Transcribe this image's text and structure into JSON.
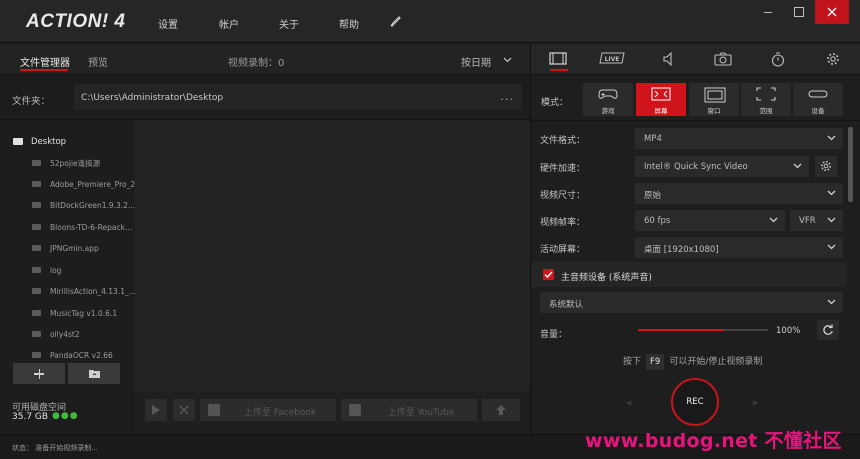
{
  "app": {
    "logo": "ACTION! 4"
  },
  "menu": {
    "settings": "设置",
    "account": "帐户",
    "about": "关于",
    "help": "帮助"
  },
  "left": {
    "tabs": {
      "file_manager": "文件管理器",
      "preview": "预览"
    },
    "video_count": "视频录制：0",
    "sort_label": "按日期",
    "folder": {
      "label": "文件夹：",
      "path": "C:\\Users\\Administrator\\Desktop",
      "more": "..."
    },
    "tree": {
      "root": "Desktop",
      "items": [
        "52pojie逢搞源",
        "Adobe_Premiere_Pro_20",
        "BitDockGreen1.9.3.2...",
        "Bloons-TD-6-Repack...",
        "JPNGmin.app",
        "log",
        "MirillisAction_4.13.1_...",
        "MusicTag v1.0.6.1",
        "olly4st2",
        "PandaOCR v2.66"
      ]
    },
    "disk": {
      "label": "可用磁盘空间",
      "value": "35.7 GB",
      "dots": "●●●"
    },
    "actions": {
      "facebook": "上传至 Facebook",
      "youtube": "上传至 YouTube"
    }
  },
  "right": {
    "mode": {
      "label": "模式：",
      "options": [
        {
          "label": "游戏",
          "icon": "gamepad-icon"
        },
        {
          "label": "屏幕",
          "icon": "fullscreen-icon",
          "active": true
        },
        {
          "label": "窗口",
          "icon": "window-icon"
        },
        {
          "label": "范围",
          "icon": "area-icon"
        },
        {
          "label": "设备",
          "icon": "device-icon"
        }
      ]
    },
    "settings": {
      "format": {
        "label": "文件格式：",
        "value": "MP4"
      },
      "hw_accel": {
        "label": "硬件加速：",
        "value": "Intel® Quick Sync Video"
      },
      "video_size": {
        "label": "视频尺寸：",
        "value": "原始"
      },
      "fps": {
        "label": "视频帧率：",
        "value": "60 fps",
        "mode": "VFR"
      },
      "active_screen": {
        "label": "活动屏幕：",
        "value": "桌面 [1920x1080]"
      },
      "audio": {
        "label": "主音频设备 (系统声音)",
        "checked": true,
        "device": "系统默认"
      },
      "volume": {
        "label": "音量：",
        "value": "100%",
        "level": 0.66
      }
    },
    "hint": {
      "before": "按下",
      "key": "F9",
      "after": "可以开始/停止视频录制"
    },
    "rec_label": "REC"
  },
  "status": {
    "text": "状态：  准备开始视频录制..."
  },
  "watermark": "www.budog.net 不懂社区",
  "colors": {
    "accent": "#d0141c",
    "background": "#1e1e1e",
    "watermark": "#e8147e"
  }
}
